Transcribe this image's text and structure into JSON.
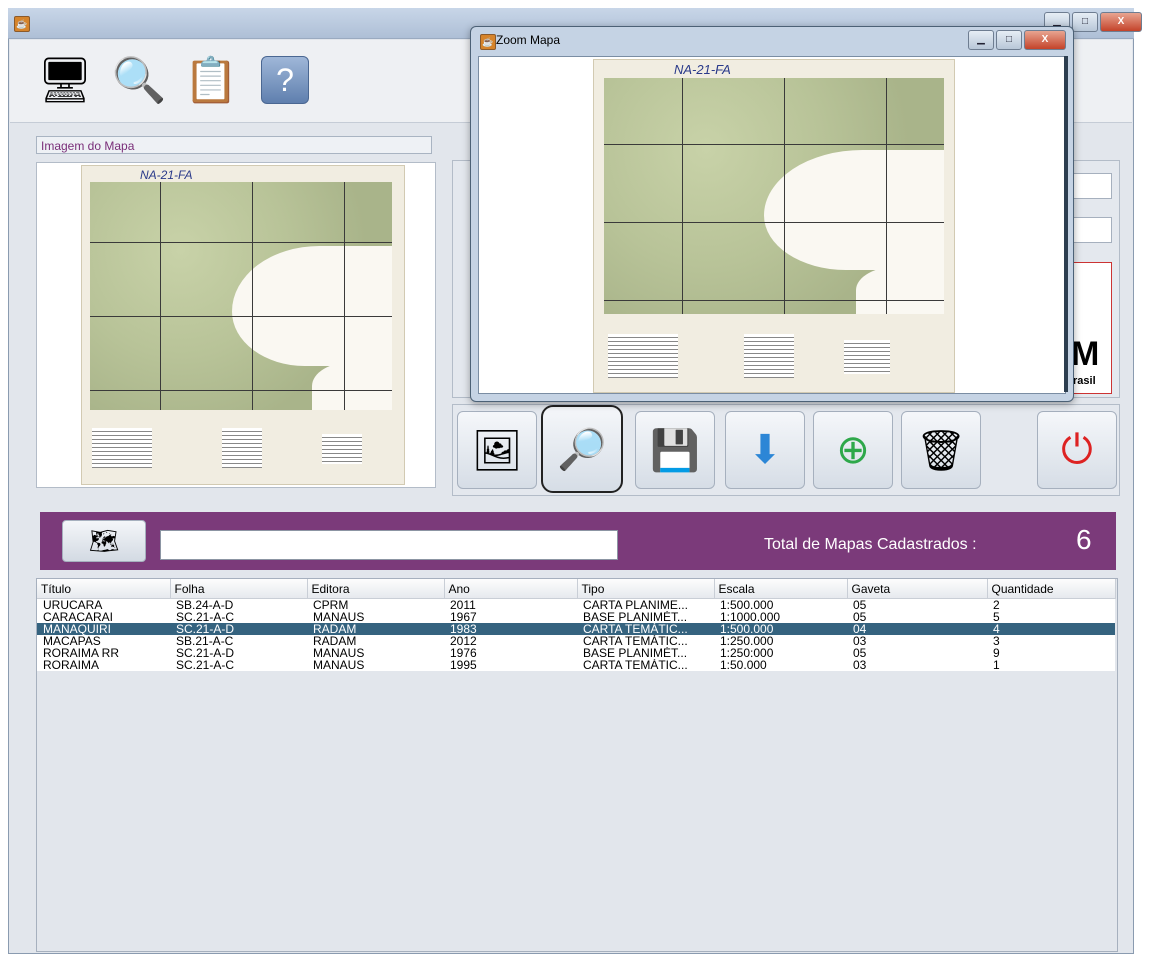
{
  "zoom_window": {
    "title": "Zoom Mapa"
  },
  "map_panel": {
    "label": "Imagem do Mapa",
    "map_sheet_code": "NA-21-FA"
  },
  "logo": {
    "text_big": "M",
    "text_small": "rasil"
  },
  "icons": {
    "toolbar": [
      "computer-icon",
      "search-screen-icon",
      "checklist-icon",
      "help-icon"
    ],
    "actions": [
      "image-capture-icon",
      "zoom-map-icon",
      "save-icon",
      "download-icon",
      "add-document-icon",
      "recycle-bin-icon",
      "exit-power-icon"
    ],
    "search": "map-search-icon"
  },
  "search": {
    "value": "",
    "total_label": "Total de Mapas Cadastrados  :",
    "total_count": "6"
  },
  "table": {
    "columns": [
      "Título",
      "Folha",
      "Editora",
      "Ano",
      "Tipo",
      "Escala",
      "Gaveta",
      "Quantidade"
    ],
    "rows": [
      [
        "URUCARA",
        "SB.24-A-D",
        "CPRM",
        "2011",
        "CARTA PLANIME...",
        "1:500.000",
        "05",
        "2"
      ],
      [
        "CARACARAI",
        "SC.21-A-C",
        "MANAUS",
        "1967",
        "BASE PLANIMÉT...",
        "1:1000.000",
        "05",
        "5"
      ],
      [
        "MANAQUIRI",
        "SC.21-A-D",
        "RADAM",
        "1983",
        "CARTA TEMÁTIC...",
        "1:500.000",
        "04",
        "4"
      ],
      [
        "MACAPAS",
        "SB.21-A-C",
        "RADAM",
        "2012",
        "CARTA TEMÁTIC...",
        "1:250.000",
        "03",
        "3"
      ],
      [
        "RORAIMA RR",
        "SC.21-A-D",
        "MANAUS",
        "1976",
        "BASE PLANIMÉT...",
        "1:250:000",
        "05",
        "9"
      ],
      [
        "RORAIMA",
        "SC.21-A-C",
        "MANAUS",
        "1995",
        "CARTA TEMÁTIC...",
        "1:50.000",
        "03",
        "1"
      ]
    ],
    "selected_row": 2
  },
  "colors": {
    "accent": "#7b3a7a",
    "selection": "#35637f"
  }
}
